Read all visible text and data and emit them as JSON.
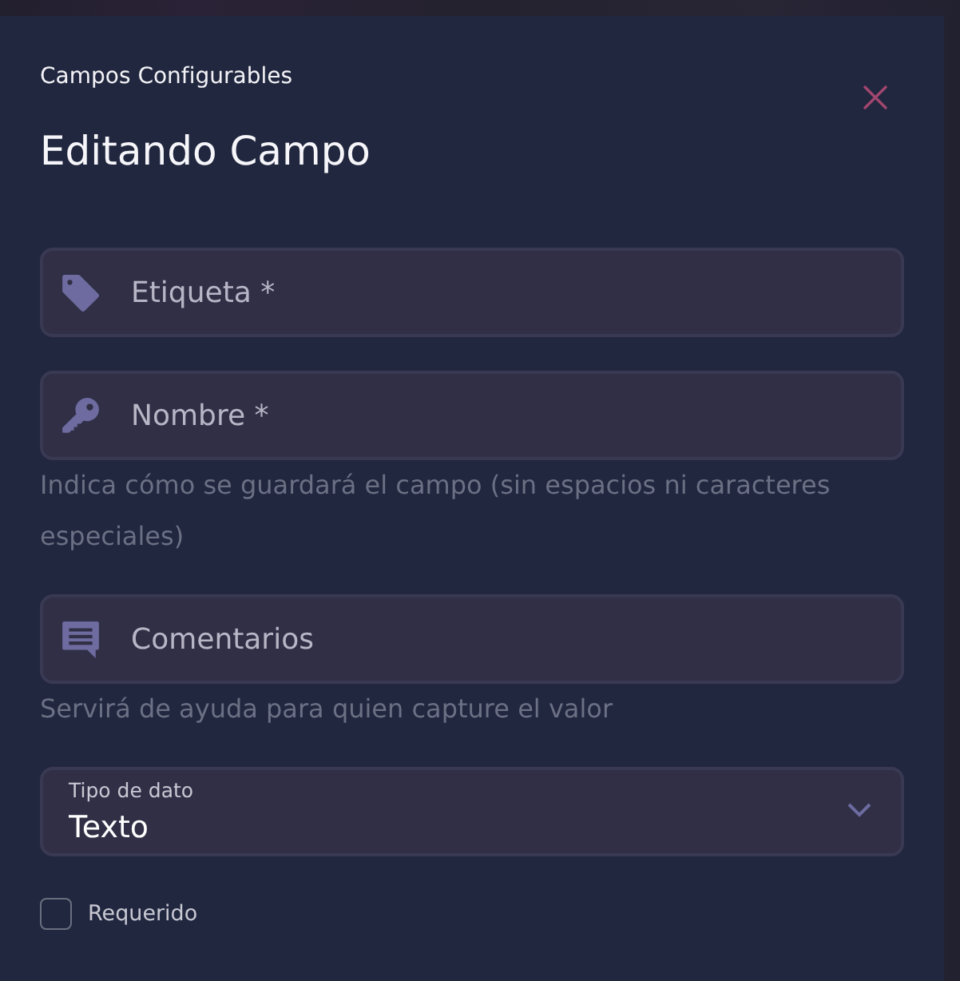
{
  "modal": {
    "subtitle": "Campos Configurables",
    "title": "Editando Campo"
  },
  "label_field": {
    "placeholder": "Etiqueta *"
  },
  "name_field": {
    "placeholder": "Nombre *",
    "help": "Indica cómo se guardará el campo (sin espacios ni caracteres especiales)"
  },
  "comments_field": {
    "placeholder": "Comentarios",
    "help": "Servirá de ayuda para quien capture el valor"
  },
  "data_type_select": {
    "label": "Tipo de dato",
    "value": "Texto"
  },
  "required_checkbox": {
    "label": "Requerido",
    "checked": false
  }
}
